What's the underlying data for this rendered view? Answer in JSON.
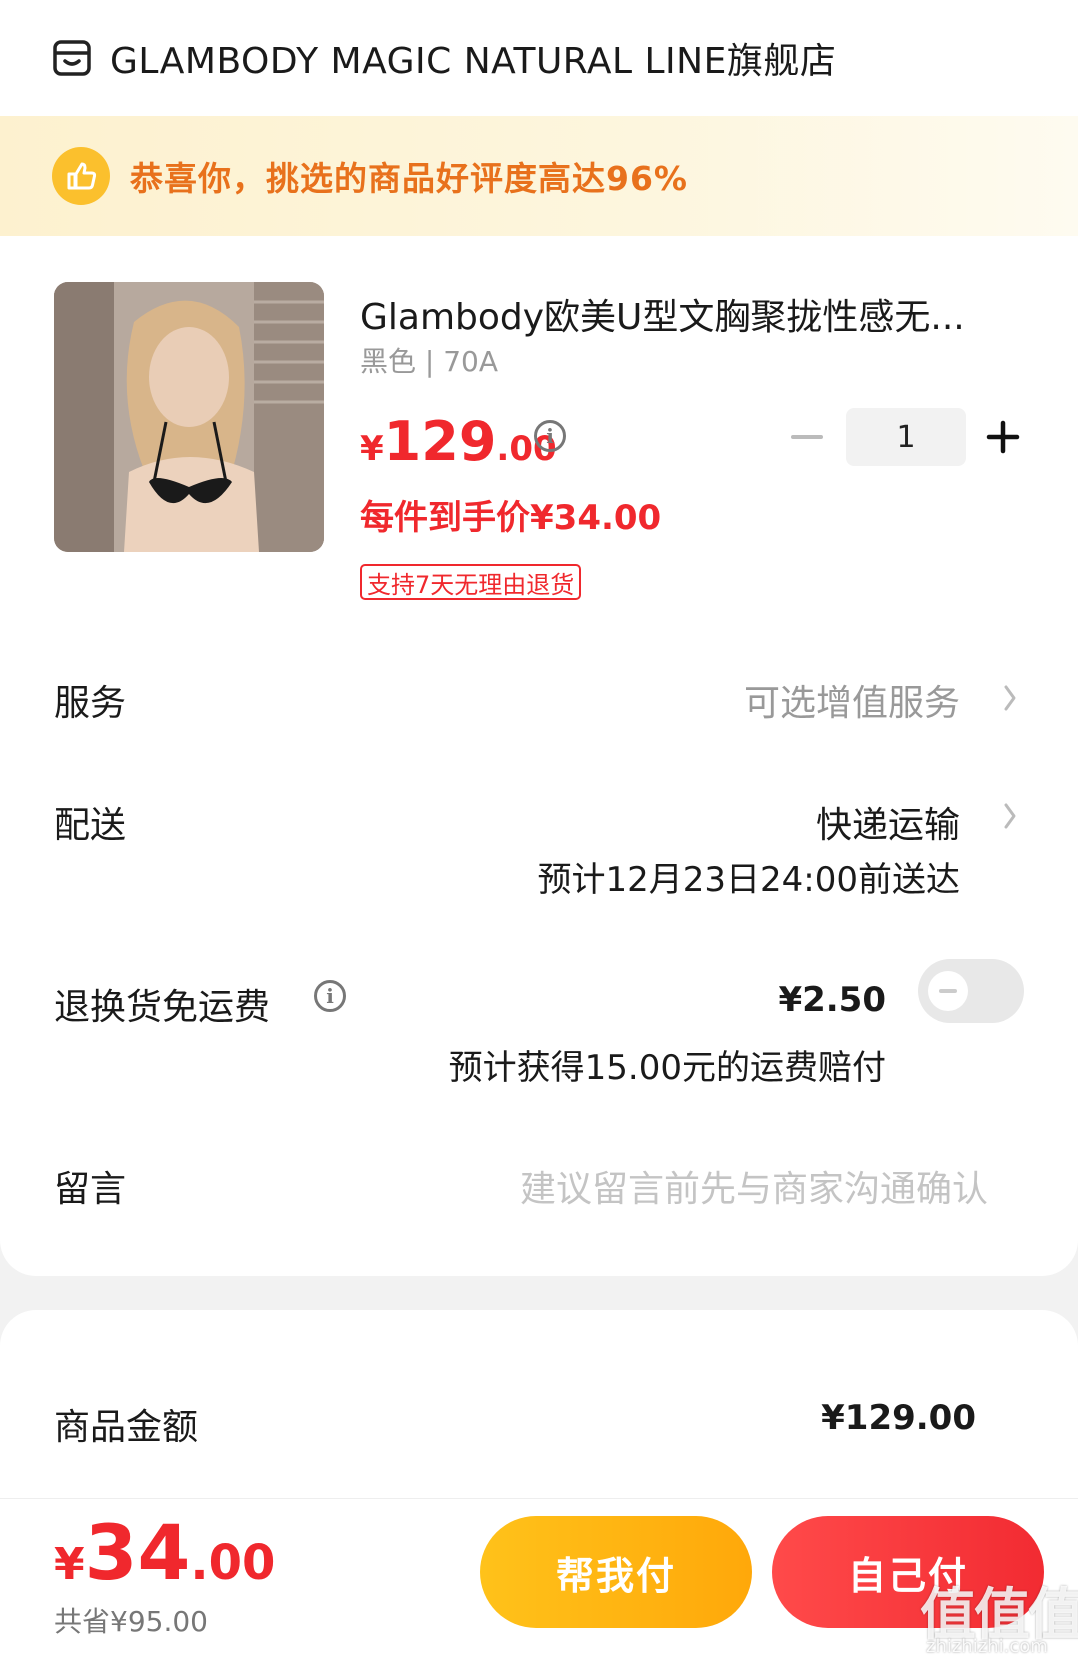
{
  "store": {
    "name": "GLAMBODY MAGIC NATURAL LINE旗舰店",
    "icon": "store-icon"
  },
  "promo": {
    "text": "恭喜你，挑选的商品好评度高达96%",
    "icon": "thumbs-up-icon"
  },
  "product": {
    "title": "Glambody欧美U型文胸聚拢性感无...",
    "spec": "黑色 | 70A",
    "price_currency": "¥",
    "price_int": "129",
    "price_dec": ".00",
    "quantity": "1",
    "unit_price": "每件到手价¥34.00",
    "return_badge": "支持7天无理由退货"
  },
  "rows": {
    "service_label": "服务",
    "service_value": "可选增值服务",
    "delivery_label": "配送",
    "delivery_value": "快递运输",
    "delivery_eta": "预计12月23日24:00前送达",
    "freight_label": "退换货免运费",
    "freight_price": "¥2.50",
    "freight_note": "预计获得15.00元的运费赔付",
    "freight_enabled": false,
    "message_label": "留言",
    "message_placeholder": "建议留言前先与商家沟通确认"
  },
  "summary": {
    "goods_amount_label": "商品金额",
    "goods_amount_value": "¥129.00"
  },
  "footer": {
    "total_currency": "¥",
    "total_int": "34",
    "total_dec": ".00",
    "saved": "共省¥95.00",
    "help_pay_label": "帮我付",
    "self_pay_label": "自己付"
  },
  "watermark": {
    "text": "值值值",
    "sub": "zhizhizhi.com"
  },
  "colors": {
    "accent_red": "#f0282d",
    "promo_orange": "#e8711c",
    "help_button": "#ffb80f",
    "self_button": "#f43538"
  }
}
